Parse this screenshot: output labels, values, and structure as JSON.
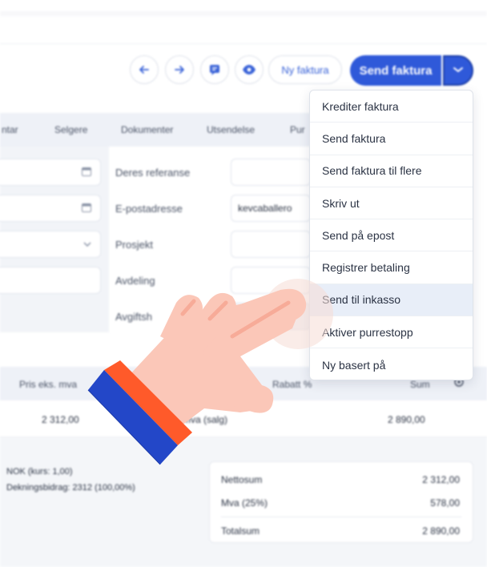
{
  "toolbar": {
    "new_invoice_label": "Ny faktura",
    "send_invoice_label": "Send faktura",
    "accent": "#2f59d9"
  },
  "tabs": [
    "ntar",
    "Selgere",
    "Dokumenter",
    "Utsendelse",
    "Pur"
  ],
  "form": {
    "labels": [
      "Deres referanse",
      "E-postadresse",
      "Prosjekt",
      "Avdeling",
      "Avgiftsh"
    ],
    "email_value": "kevcaballero"
  },
  "table": {
    "headers": [
      "Pris eks. mva",
      "Rabatt %",
      "Sum"
    ],
    "row": {
      "price": "2 312,00",
      "vat": "mva (salg)",
      "sum": "2 890,00"
    }
  },
  "footer": {
    "currency_line": "NOK (kurs: 1,00)",
    "margin_line": "Dekningsbidrag: 2312 (100,00%)",
    "summary": [
      {
        "label": "Nettosum",
        "value": "2 312,00"
      },
      {
        "label": "Mva (25%)",
        "value": "578,00"
      },
      {
        "label": "Totalsum",
        "value": "2 890,00"
      }
    ]
  },
  "menu": {
    "items": [
      "Krediter faktura",
      "Send faktura",
      "Send faktura til flere",
      "Skriv ut",
      "Send på epost",
      "Registrer betaling",
      "Send til inkasso",
      "Aktiver purrestopp",
      "Ny basert på"
    ],
    "active_index": 6
  }
}
